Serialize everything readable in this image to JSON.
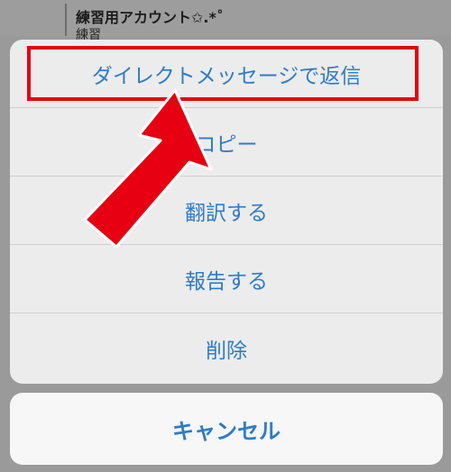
{
  "background": {
    "account_title": "練習用アカウント✩.*˚",
    "account_subtitle": "練習"
  },
  "action_sheet": {
    "items": [
      {
        "label": "ダイレクトメッセージで返信"
      },
      {
        "label": "コピー"
      },
      {
        "label": "翻訳する"
      },
      {
        "label": "報告する"
      },
      {
        "label": "削除"
      }
    ],
    "cancel_label": "キャンセル"
  },
  "colors": {
    "action_text": "#2f7bc6",
    "highlight": "#e60012",
    "arrow": "#e60012"
  }
}
